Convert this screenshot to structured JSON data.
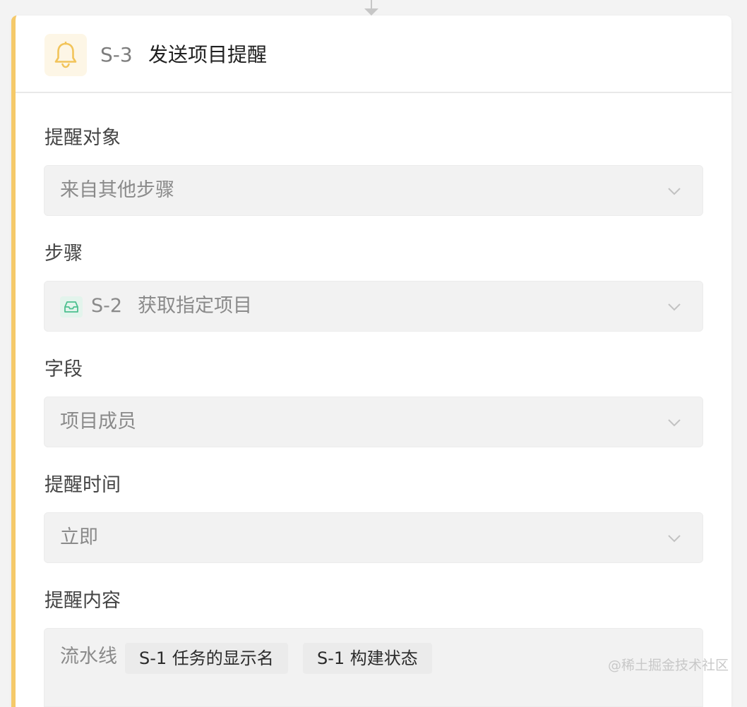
{
  "step": {
    "icon": "bell-icon",
    "id": "S-3",
    "title": "发送项目提醒"
  },
  "fields": {
    "target": {
      "label": "提醒对象",
      "value": "来自其他步骤"
    },
    "step_ref": {
      "label": "步骤",
      "icon": "inbox-icon",
      "id": "S-2",
      "name": "获取指定项目"
    },
    "field": {
      "label": "字段",
      "value": "项目成员"
    },
    "time": {
      "label": "提醒时间",
      "value": "立即"
    },
    "content": {
      "label": "提醒内容",
      "prefix": "流水线",
      "variables": [
        "S-1 任务的显示名",
        "S-1 构建状态"
      ]
    }
  },
  "watermark": "@稀土掘金技术社区",
  "colors": {
    "accent": "#f5c969",
    "bell": "#f2c45a",
    "inbox": "#4cc08f"
  }
}
